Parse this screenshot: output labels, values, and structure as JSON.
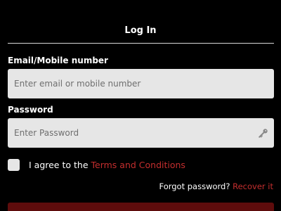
{
  "header": {
    "title": "Log In"
  },
  "email_field": {
    "label": "Email/Mobile number",
    "placeholder": "Enter email or mobile number",
    "value": ""
  },
  "password_field": {
    "label": "Password",
    "placeholder": "Enter Password",
    "value": "",
    "icon": "key-icon"
  },
  "terms": {
    "checked": false,
    "prefix": "I agree to the",
    "link_text": "Terms and Conditions"
  },
  "forgot": {
    "prompt": "Forgot password?",
    "link_text": "Recover it"
  },
  "colors": {
    "background": "#000000",
    "link": "#c42e2e",
    "input_bg": "#e6e6e6",
    "button": "#5e0c0c"
  }
}
